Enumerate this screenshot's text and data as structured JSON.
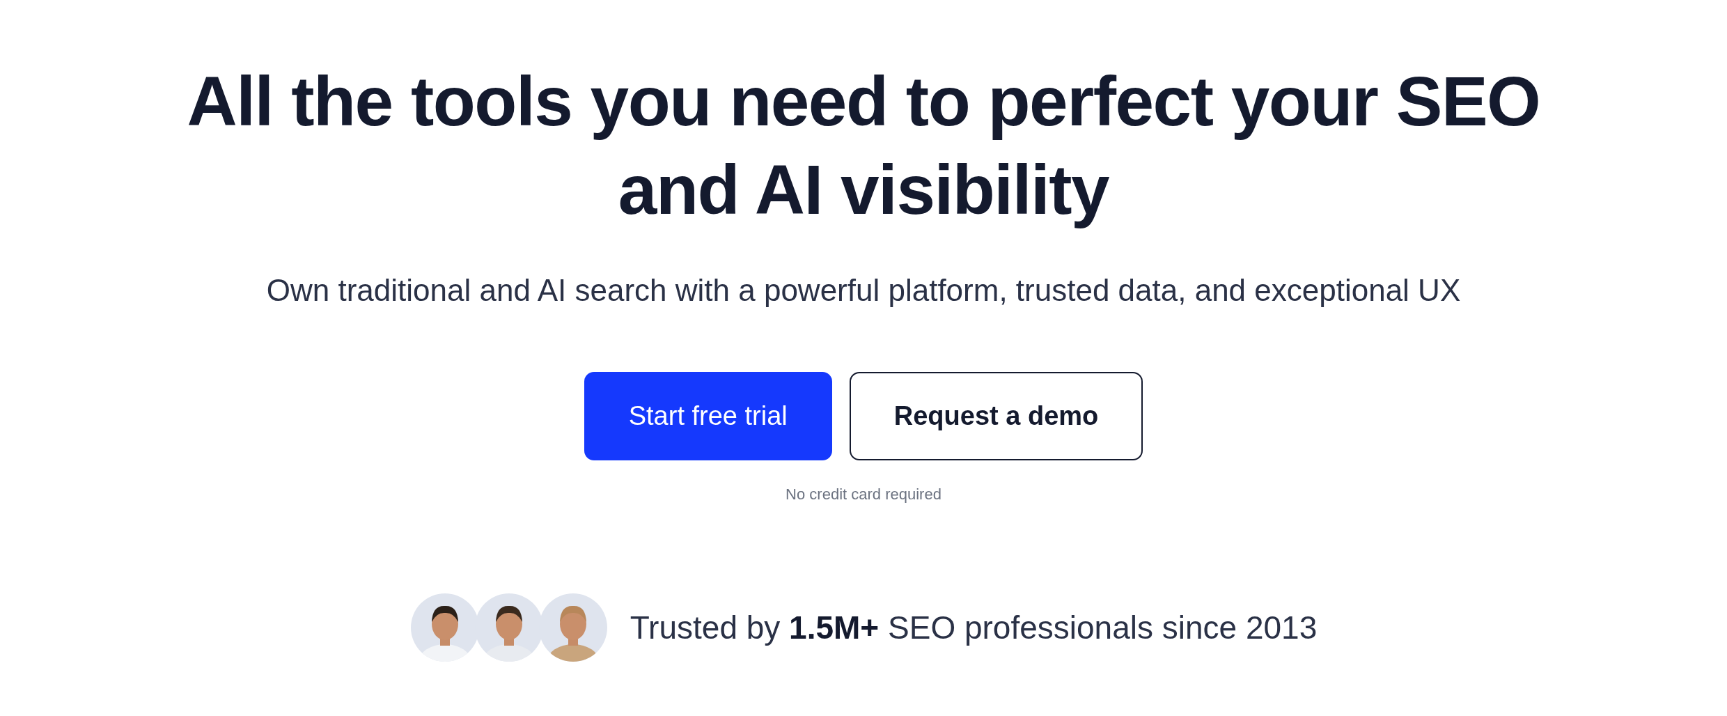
{
  "headline": [
    "All the tools you need to perfect your SEO",
    "and AI visibility"
  ],
  "subtitle": "Own traditional and AI search with a powerful platform, trusted data, and exceptional UX",
  "buttons": [
    {
      "label": "Start free trial",
      "kind": "primary"
    },
    {
      "label": "Request a demo",
      "kind": "secondary"
    }
  ],
  "note": "No credit card required",
  "trust": {
    "text": "Trusted by **1.5M+** SEO professionals since 2013"
  }
}
